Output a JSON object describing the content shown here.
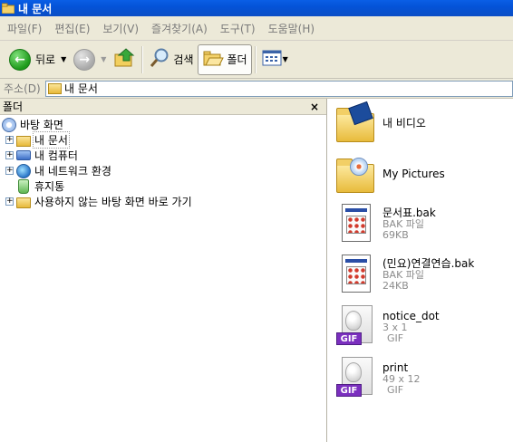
{
  "window": {
    "title": "내 문서"
  },
  "menu": [
    "파일(F)",
    "편집(E)",
    "보기(V)",
    "즐겨찾기(A)",
    "도구(T)",
    "도움말(H)"
  ],
  "toolbar": {
    "back_label": "뒤로",
    "search_label": "검색",
    "folders_label": "폴더"
  },
  "address": {
    "label": "주소(D)",
    "value": "내 문서"
  },
  "folders_pane": {
    "title": "폴더",
    "close_glyph": "×",
    "tree": [
      {
        "label": "바탕 화면",
        "icon": "desktop-icon",
        "expander": ""
      },
      {
        "label": "내 문서",
        "icon": "my-documents-icon",
        "expander": "+"
      },
      {
        "label": "내 컴퓨터",
        "icon": "my-computer-icon",
        "expander": "+"
      },
      {
        "label": "내 네트워크 환경",
        "icon": "network-places-icon",
        "expander": "+"
      },
      {
        "label": "휴지통",
        "icon": "recycle-bin-icon",
        "expander": ""
      },
      {
        "label": "사용하지 않는 바탕 화면 바로 가기",
        "icon": "folder-icon",
        "expander": "+"
      }
    ]
  },
  "files": [
    {
      "name": "내 비디오",
      "icon": "my-videos-folder-icon",
      "lines": []
    },
    {
      "name": "My Pictures",
      "icon": "my-pictures-folder-icon",
      "lines": []
    },
    {
      "name": "문서표.bak",
      "icon": "bak-file-icon",
      "lines": [
        "BAK 파일",
        "69KB"
      ]
    },
    {
      "name": "(민요)연결연습.bak",
      "icon": "bak-file-icon",
      "lines": [
        "BAK 파일",
        "24KB"
      ]
    },
    {
      "name": "notice_dot",
      "icon": "gif-file-icon",
      "lines": [
        "3 x 1",
        "GIF"
      ],
      "badge": "GIF"
    },
    {
      "name": "print",
      "icon": "gif-file-icon",
      "lines": [
        "49 x 12",
        "GIF"
      ],
      "badge": "GIF"
    }
  ]
}
